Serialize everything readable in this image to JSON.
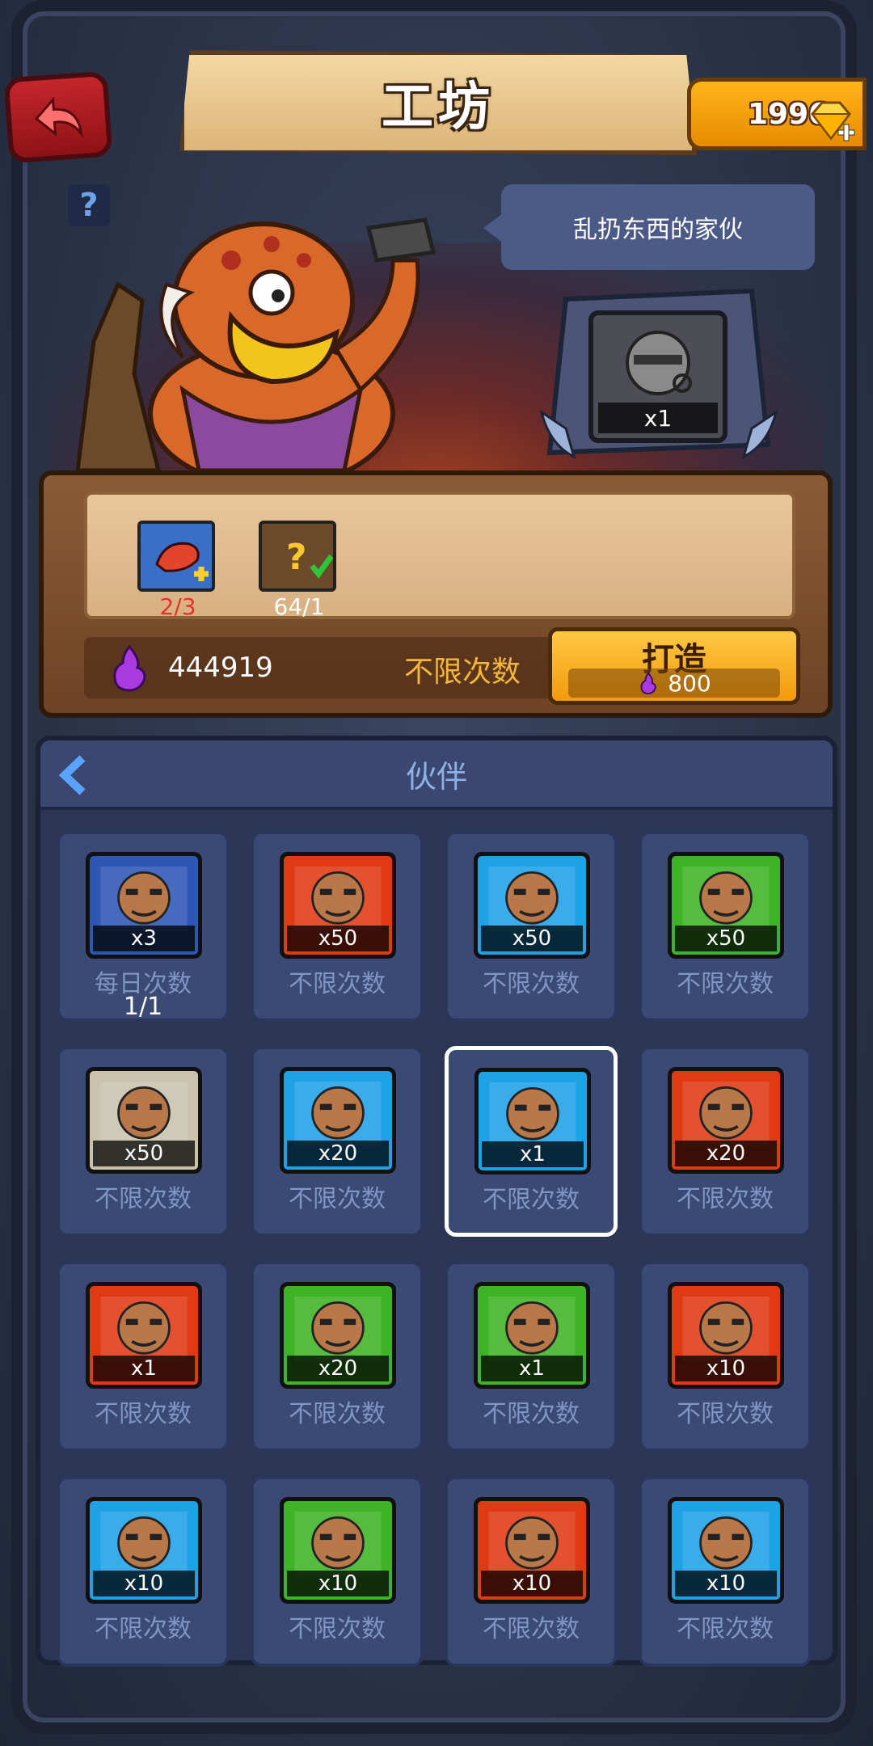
{
  "header": {
    "title": "工坊",
    "gems": "1996"
  },
  "character": {
    "speech": "乱扔东西的家伙"
  },
  "target": {
    "count": "x1"
  },
  "materials": [
    {
      "icon": "shrimp-icon",
      "count": "2/3",
      "count_color": "#e8302a"
    },
    {
      "icon": "mystery-piece-icon",
      "count": "64/1",
      "count_color": "#ffffff"
    }
  ],
  "currency": {
    "value": "444919",
    "limit_label": "不限次数"
  },
  "craft": {
    "label": "打造",
    "cost": "800"
  },
  "partners": {
    "title": "伙伴",
    "cards": [
      {
        "color": "#2d57b5",
        "count": "x3",
        "label": "每日次数",
        "sub": "1/1",
        "selected": false
      },
      {
        "color": "#e03a15",
        "count": "x50",
        "label": "不限次数",
        "sub": "",
        "selected": false
      },
      {
        "color": "#1fa1e6",
        "count": "x50",
        "label": "不限次数",
        "sub": "",
        "selected": false
      },
      {
        "color": "#3fb326",
        "count": "x50",
        "label": "不限次数",
        "sub": "",
        "selected": false
      },
      {
        "color": "#c9c2ad",
        "count": "x50",
        "label": "不限次数",
        "sub": "",
        "selected": false
      },
      {
        "color": "#1fa1e6",
        "count": "x20",
        "label": "不限次数",
        "sub": "",
        "selected": false
      },
      {
        "color": "#1fa1e6",
        "count": "x1",
        "label": "不限次数",
        "sub": "",
        "selected": true
      },
      {
        "color": "#e03a15",
        "count": "x20",
        "label": "不限次数",
        "sub": "",
        "selected": false
      },
      {
        "color": "#e03a15",
        "count": "x1",
        "label": "不限次数",
        "sub": "",
        "selected": false
      },
      {
        "color": "#3fb326",
        "count": "x20",
        "label": "不限次数",
        "sub": "",
        "selected": false
      },
      {
        "color": "#3fb326",
        "count": "x1",
        "label": "不限次数",
        "sub": "",
        "selected": false
      },
      {
        "color": "#e03a15",
        "count": "x10",
        "label": "不限次数",
        "sub": "",
        "selected": false
      },
      {
        "color": "#1fa1e6",
        "count": "x10",
        "label": "不限次数",
        "sub": "",
        "selected": false
      },
      {
        "color": "#3fb326",
        "count": "x10",
        "label": "不限次数",
        "sub": "",
        "selected": false
      },
      {
        "color": "#e03a15",
        "count": "x10",
        "label": "不限次数",
        "sub": "",
        "selected": false
      },
      {
        "color": "#1fa1e6",
        "count": "x10",
        "label": "不限次数",
        "sub": "",
        "selected": false
      }
    ]
  }
}
